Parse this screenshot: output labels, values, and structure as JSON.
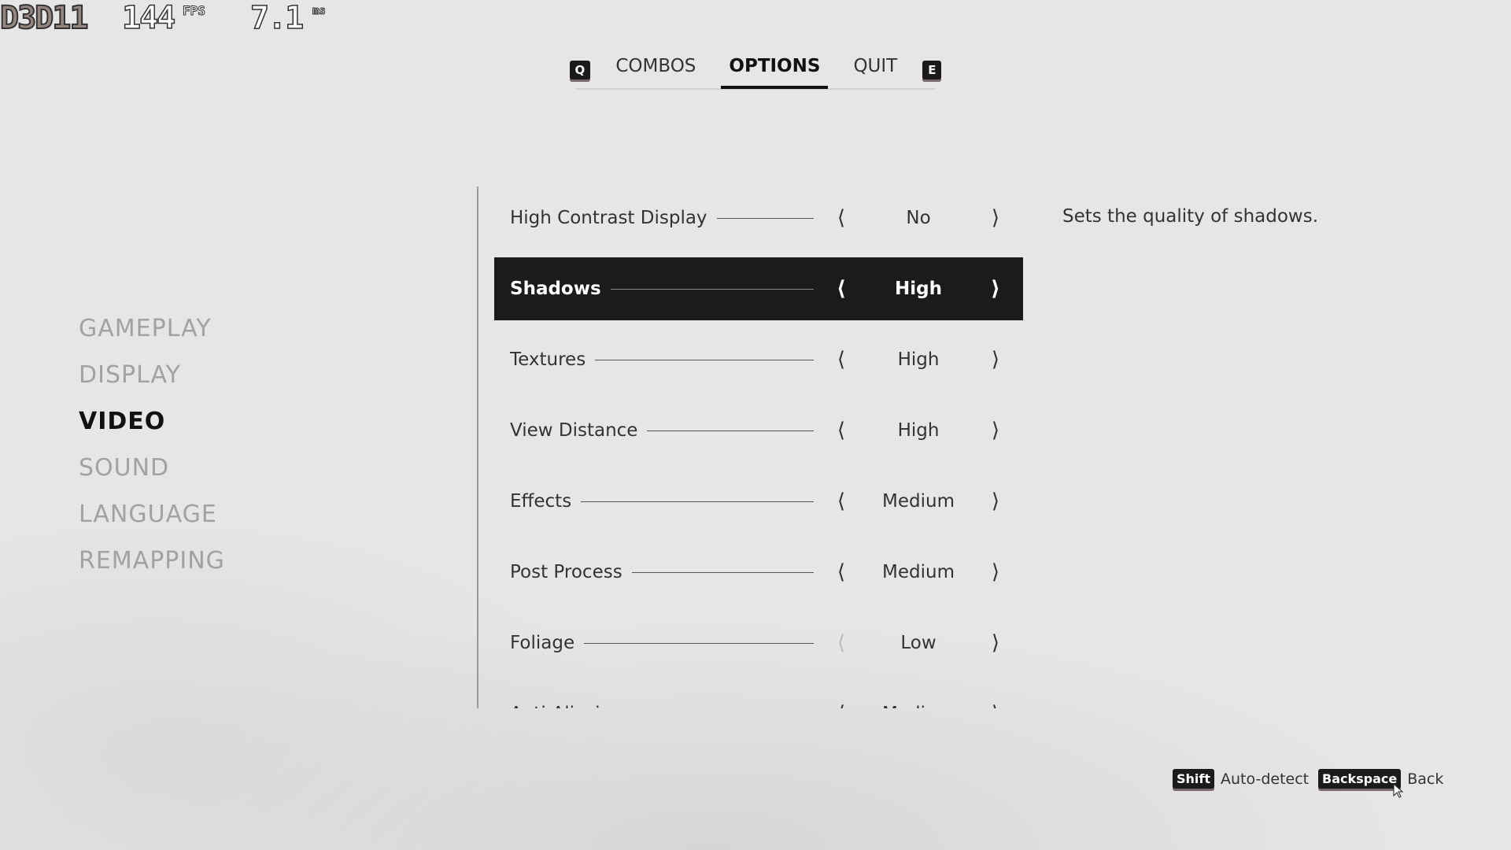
{
  "hud": {
    "api": "D3D11",
    "fps": "144",
    "fps_unit": "FPS",
    "frametime": "7.1",
    "frametime_unit": "ms"
  },
  "tabs": {
    "prev_key": "Q",
    "next_key": "E",
    "items": [
      {
        "label": "COMBOS"
      },
      {
        "label": "OPTIONS",
        "active": true
      },
      {
        "label": "QUIT"
      }
    ]
  },
  "menu": [
    "GAMEPLAY",
    "DISPLAY",
    "VIDEO",
    "SOUND",
    "LANGUAGE",
    "REMAPPING"
  ],
  "menu_active": "VIDEO",
  "settings": [
    {
      "label": "High Contrast Display",
      "value": "No"
    },
    {
      "label": "Shadows",
      "value": "High",
      "selected": true
    },
    {
      "label": "Textures",
      "value": "High"
    },
    {
      "label": "View Distance",
      "value": "High"
    },
    {
      "label": "Effects",
      "value": "Medium"
    },
    {
      "label": "Post Process",
      "value": "Medium"
    },
    {
      "label": "Foliage",
      "value": "Low",
      "left_disabled": true
    },
    {
      "label": "Anti-Aliasing",
      "value": "Medium"
    }
  ],
  "description": "Sets the quality of shadows.",
  "hints": [
    {
      "key": "Shift",
      "label": "Auto-detect"
    },
    {
      "key": "Backspace",
      "label": "Back"
    }
  ]
}
